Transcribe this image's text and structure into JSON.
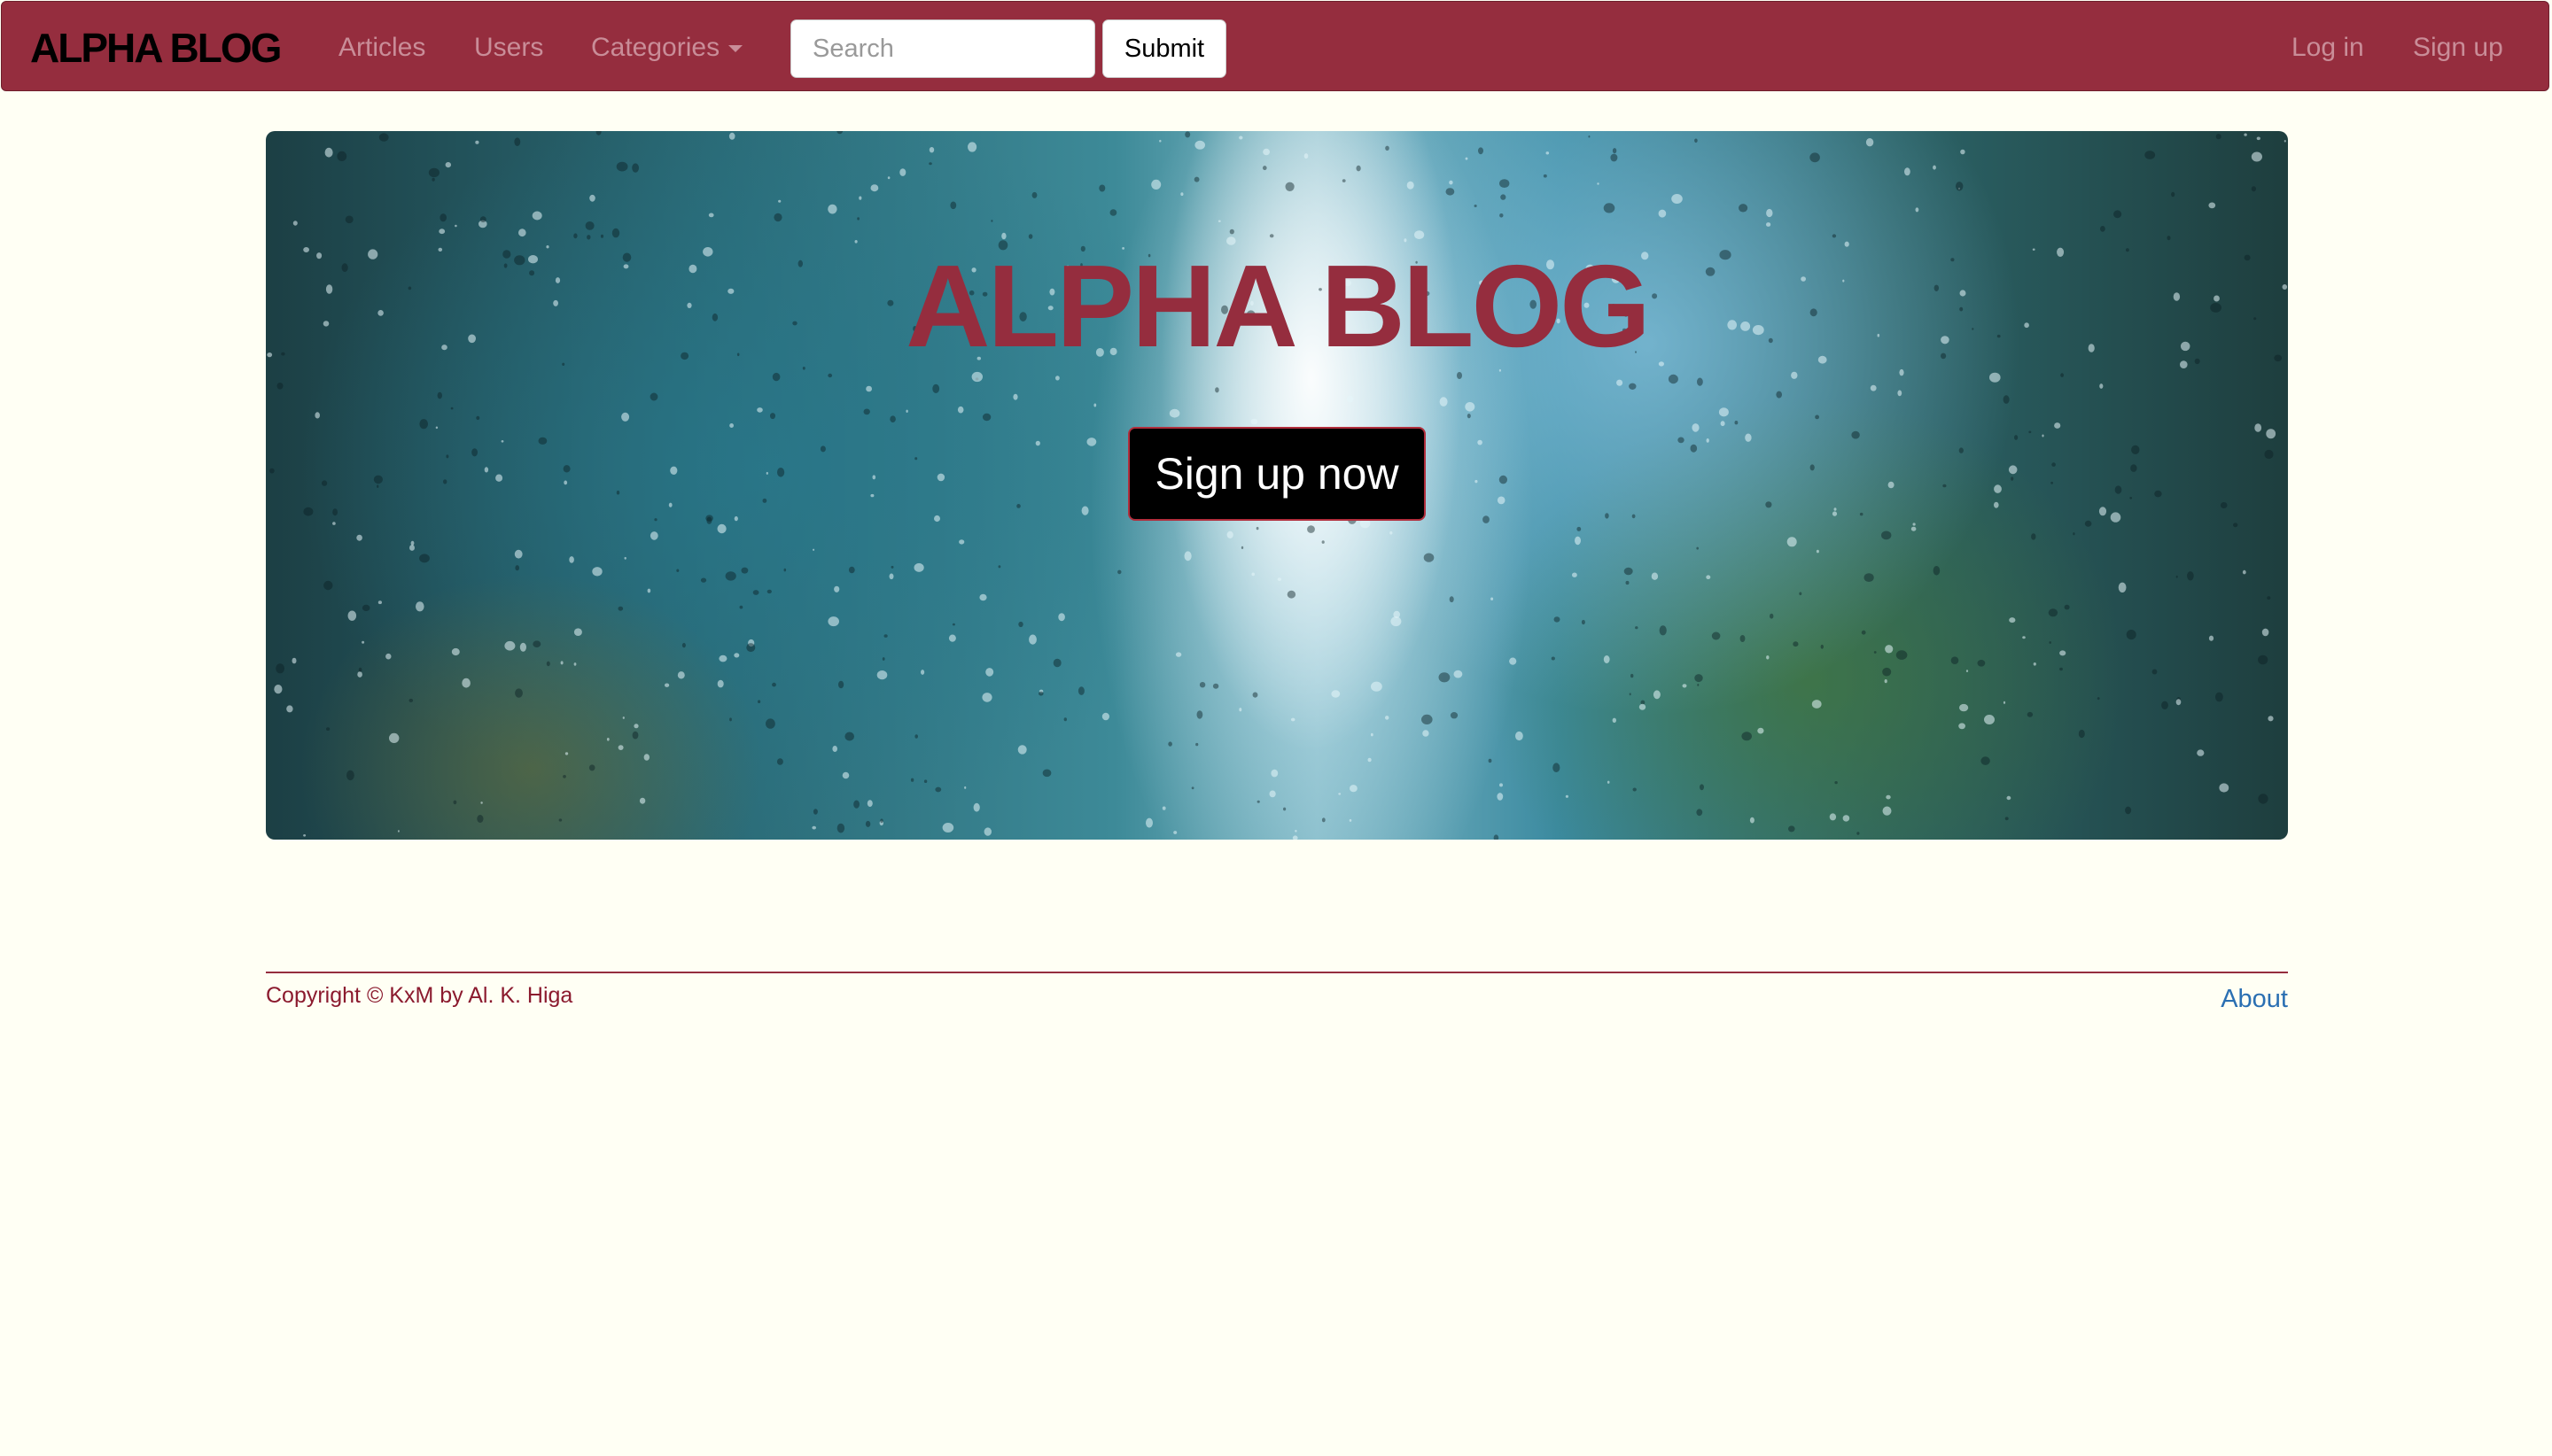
{
  "navbar": {
    "brand": "ALPHA BLOG",
    "links": {
      "articles": "Articles",
      "users": "Users",
      "categories": "Categories"
    },
    "search": {
      "placeholder": "Search",
      "value": ""
    },
    "submit_label": "Submit",
    "login_label": "Log in",
    "signup_label": "Sign up"
  },
  "hero": {
    "title": "ALPHA BLOG",
    "cta_label": "Sign up now"
  },
  "footer": {
    "copyright": "Copyright © KxM by Al. K. Higa",
    "about_label": "About"
  },
  "colors": {
    "brand": "#952d3e",
    "background": "#fffff4",
    "nav_link": "#c98d98",
    "link": "#2a6fb2"
  },
  "icons": {
    "categories_dropdown": "caret-down-icon"
  }
}
